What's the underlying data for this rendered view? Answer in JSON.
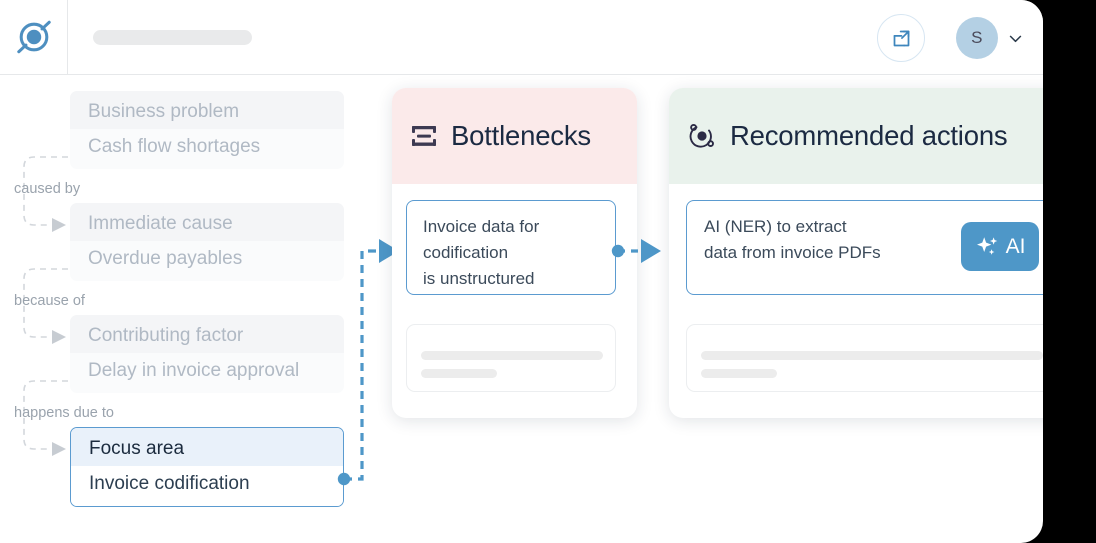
{
  "header": {
    "logo_name": "app-logo",
    "search_placeholder": "",
    "share_icon": "external-link-icon",
    "avatar_initial": "S",
    "chevron_icon": "chevron-down-icon"
  },
  "tree": {
    "nodes": [
      {
        "type_label": "Business problem",
        "value": "Cash flow shortages",
        "focused": false
      },
      {
        "type_label": "Immediate cause",
        "value": "Overdue payables",
        "focused": false
      },
      {
        "type_label": "Contributing factor",
        "value": "Delay in invoice approval",
        "focused": false
      },
      {
        "type_label": "Focus area",
        "value": "Invoice codification",
        "focused": true
      }
    ],
    "relations": [
      "caused by",
      "because of",
      "happens due to"
    ]
  },
  "panels": [
    {
      "id": "bottlenecks",
      "title": "Bottlenecks",
      "icon": "bottleneck-funnel-icon",
      "head_color": "#fbeaea",
      "card_text": "Invoice data for codification is unstructured",
      "card_lines": [
        "Invoice data for",
        "codification",
        "is unstructured"
      ]
    },
    {
      "id": "actions",
      "title": "Recommended actions",
      "icon": "atom-orbit-icon",
      "head_color": "#e9f2ec",
      "card_text": "AI (NER) to extract data from invoice PDFs",
      "card_lines": [
        "AI (NER) to extract",
        "data from invoice PDFs"
      ],
      "badge_label": "AI",
      "badge_icon": "sparkle-icon",
      "badge_color": "#4e97c8"
    }
  ],
  "colors": {
    "accent_blue": "#4e97c8",
    "connector_blue": "#4e97c8",
    "tree_muted": "#b0b9c4",
    "focus_border": "#5b9bd0"
  }
}
